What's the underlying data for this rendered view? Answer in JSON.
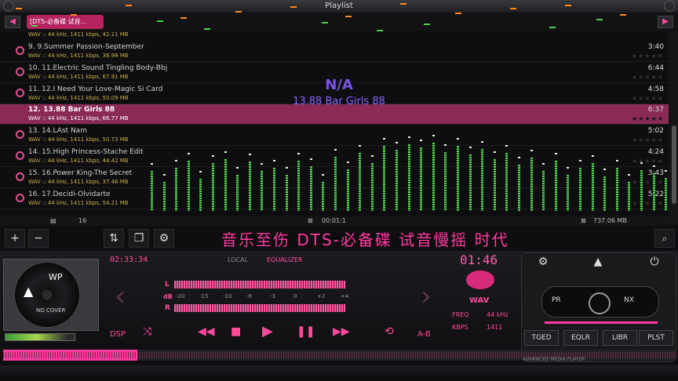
{
  "window": {
    "title": "Playlist"
  },
  "header": {
    "tag": "[DTS-必备碟 试音..."
  },
  "top_dashes": [
    [
      20,
      10,
      "#ff8a1a"
    ],
    [
      90,
      18,
      "#ff8a1a"
    ],
    [
      160,
      6,
      "#ff8a1a"
    ],
    [
      230,
      22,
      "#ff8a1a"
    ],
    [
      300,
      14,
      "#ff8a1a"
    ],
    [
      370,
      8,
      "#ff8a1a"
    ],
    [
      440,
      20,
      "#ff8a1a"
    ],
    [
      510,
      4,
      "#ff8a1a"
    ],
    [
      580,
      16,
      "#ff8a1a"
    ],
    [
      650,
      10,
      "#ff8a1a"
    ],
    [
      720,
      6,
      "#ff8a1a"
    ],
    [
      790,
      18,
      "#ff8a1a"
    ],
    [
      40,
      32,
      "#4fd04f"
    ],
    [
      120,
      40,
      "#4fd04f"
    ],
    [
      200,
      26,
      "#4fd04f"
    ],
    [
      260,
      36,
      "#4fd04f"
    ],
    [
      340,
      44,
      "#4fd04f"
    ],
    [
      410,
      28,
      "#4fd04f"
    ],
    [
      480,
      38,
      "#4fd04f"
    ],
    [
      540,
      30,
      "#4fd04f"
    ],
    [
      620,
      42,
      "#4fd04f"
    ],
    [
      700,
      34,
      "#4fd04f"
    ],
    [
      760,
      24,
      "#4fd04f"
    ],
    [
      820,
      40,
      "#4fd04f"
    ]
  ],
  "playlist": {
    "top_info": "WAV :: 44 kHz, 1411 kbps, 42.11 MB",
    "rows": [
      {
        "title": "9. 9.Summer Passion-September",
        "info": "WAV :: 44 kHz, 1411 kbps, 36.98 MB",
        "duration": "3:40",
        "selected": false
      },
      {
        "title": "10. 11.Electric Sound Tingling Body-Bbj",
        "info": "WAV :: 44 kHz, 1411 kbps, 67.91 MB",
        "duration": "6:44",
        "selected": false
      },
      {
        "title": "11. 12.I Need Your Love-Magic Si Card",
        "info": "WAV :: 44 kHz, 1411 kbps, 50.09 MB",
        "duration": "4:58",
        "selected": false
      },
      {
        "title": "12. 13.88 Bar Girls 88",
        "info": "WAV :: 44 kHz, 1411 kbps, 66.77 MB",
        "duration": "6:37",
        "selected": true
      },
      {
        "title": "13. 14.LAst Nam",
        "info": "WAV :: 44 kHz, 1411 kbps, 50.73 MB",
        "duration": "5:02",
        "selected": false
      },
      {
        "title": "14. 15.High Princess-Stache Edit",
        "info": "WAV :: 44 kHz, 1411 kbps, 44.42 MB",
        "duration": "4:24",
        "selected": false
      },
      {
        "title": "15. 16.Power King-The Secret",
        "info": "WAV :: 44 kHz, 1411 kbps, 37.46 MB",
        "duration": "3:43",
        "selected": false
      },
      {
        "title": "16. 17.Decidi-Olvidarte",
        "info": "WAV :: 44 kHz, 1411 kbps, 54.21 MB",
        "duration": "5:22",
        "selected": false
      }
    ]
  },
  "now_playing": {
    "artist": "N/A",
    "title": "13.88 Bar Girls 88"
  },
  "spectrum": [
    0.55,
    0.4,
    0.6,
    0.7,
    0.45,
    0.66,
    0.72,
    0.5,
    0.68,
    0.55,
    0.6,
    0.5,
    0.7,
    0.62,
    0.4,
    0.75,
    0.58,
    0.8,
    0.66,
    0.9,
    0.85,
    0.92,
    0.88,
    0.95,
    0.82,
    0.9,
    0.78,
    0.86,
    0.72,
    0.8,
    0.64,
    0.74,
    0.55,
    0.7,
    0.5,
    0.6,
    0.66,
    0.48,
    0.6,
    0.4,
    0.56,
    0.52,
    0.46
  ],
  "status": {
    "count": "16",
    "time": "00:01:1",
    "size": "737.06 MB"
  },
  "marquee": "音乐至伤  DTS-必备碟 试音慢摇  时代",
  "player": {
    "cover_label": "WP",
    "cover_caption": "NO COVER",
    "elapsed_total": "02:33:34",
    "tabs": [
      "LOCAL",
      "EQUALIZER"
    ],
    "meter_l": "L",
    "meter_r": "R",
    "meter_db": "dB",
    "scale": [
      "-20",
      "-15",
      "-10",
      "-6",
      "-3",
      "0",
      "+2",
      "+4"
    ],
    "dsp": "DSP",
    "ab": "A-B",
    "time_digital": "01:46",
    "format": "WAV",
    "freq_label": "FREQ",
    "freq_value": "44 kHz",
    "kbps_label": "KBPS",
    "kbps_value": "1411",
    "prev_label": "PR",
    "next_label": "NX",
    "func_buttons": [
      "TGED",
      "EQLR",
      "LIBR",
      "PLST"
    ],
    "footer_label": "ADVANCED MEDIA PLAYER",
    "progress": 0.2
  }
}
